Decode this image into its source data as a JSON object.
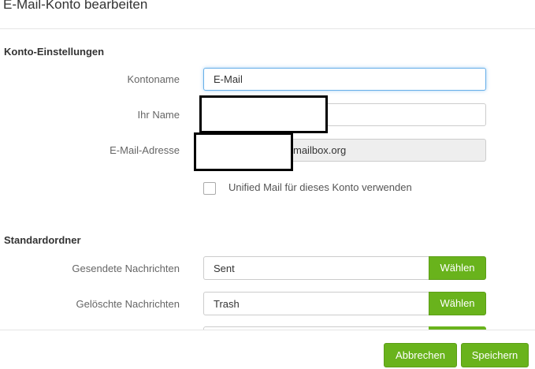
{
  "dialog": {
    "title": "E-Mail-Konto bearbeiten"
  },
  "account_settings": {
    "heading": "Konto-Einstellungen",
    "account_name": {
      "label": "Kontoname",
      "value": "E-Mail"
    },
    "your_name": {
      "label": "Ihr Name",
      "value": ""
    },
    "email_address": {
      "label": "E-Mail-Adresse",
      "value": "mailbox.org"
    },
    "unified_mail": {
      "label": "Unified Mail für dieses Konto verwenden",
      "checked": false
    }
  },
  "default_folders": {
    "heading": "Standardordner",
    "items": [
      {
        "label": "Gesendete Nachrichten",
        "value": "Sent",
        "button": "Wählen"
      },
      {
        "label": "Gelöschte Nachrichten",
        "value": "Trash",
        "button": "Wählen"
      }
    ]
  },
  "footer": {
    "cancel_label": "Abbrechen",
    "save_label": "Speichern"
  },
  "colors": {
    "accent": "#69b31c",
    "focus_border": "#66afe9"
  }
}
